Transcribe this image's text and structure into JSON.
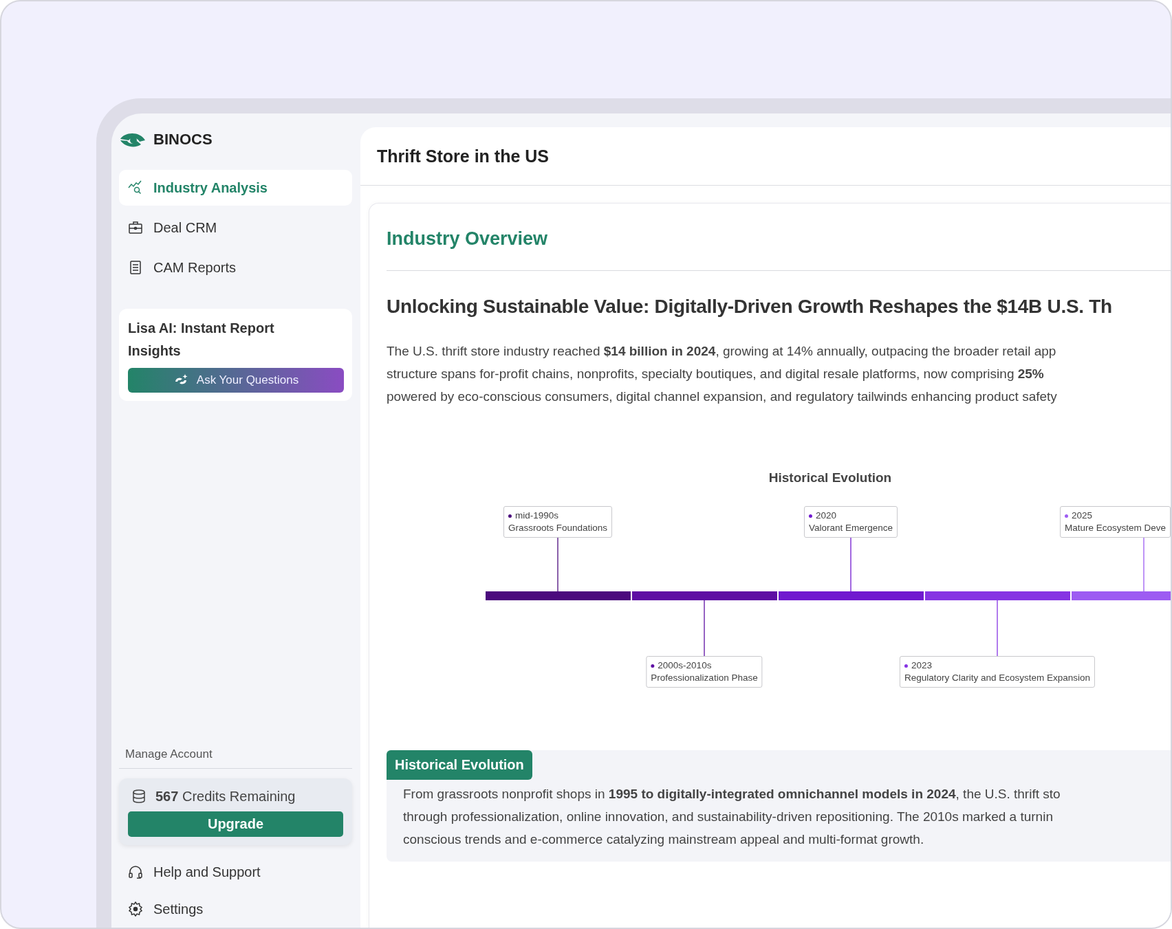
{
  "brand": {
    "name": "BINOCS"
  },
  "nav": [
    {
      "label": "Industry Analysis",
      "selected": true
    },
    {
      "label": "Deal CRM",
      "selected": false
    },
    {
      "label": "CAM Reports",
      "selected": false
    }
  ],
  "assistant": {
    "title": "Lisa AI: Instant Report Insights",
    "button": "Ask Your Questions"
  },
  "account": {
    "heading": "Manage Account",
    "credits": "**567** Credits Remaining",
    "upgrade": "Upgrade"
  },
  "footer_nav": [
    {
      "label": "Help and Support"
    },
    {
      "label": "Settings"
    }
  ],
  "page": {
    "title": "Thrift Store in the US"
  },
  "overview": {
    "heading": "Industry Overview",
    "headline": "Unlocking Sustainable Value: Digitally-Driven Growth Reshapes the $14B U.S. Th",
    "summary_lines": [
      "The U.S. thrift store industry reached **$14 billion in 2024**, growing at 14% annually, outpacing the broader retail app",
      "structure spans for-profit chains, nonprofits, specialty boutiques, and digital resale platforms, now comprising **25%**",
      "powered by eco-conscious consumers, digital channel expansion, and regulatory tailwinds enhancing product safety"
    ]
  },
  "timeline": {
    "title": "Historical Evolution",
    "events": [
      {
        "year": "mid-1990s",
        "label": "Grassroots Foundations",
        "above": true,
        "color": "#4b0a7d"
      },
      {
        "year": "2000s-2010s",
        "label": "Professionalization Phase",
        "above": false,
        "color": "#5e0fa3"
      },
      {
        "year": "2020",
        "label": "Valorant Emergence",
        "above": true,
        "color": "#7019cf"
      },
      {
        "year": "2023",
        "label": "Regulatory Clarity and Ecosystem Expansion",
        "above": false,
        "color": "#8634e3"
      },
      {
        "year": "2025",
        "label": "Mature Ecosystem Deve",
        "above": true,
        "color": "#9d5cf2"
      }
    ]
  },
  "history": {
    "badge": "Historical Evolution",
    "lines": [
      "From grassroots nonprofit shops in **1995 to digitally-integrated omnichannel models in 2024**, the U.S. thrift sto",
      "through professionalization, online innovation, and sustainability-driven repositioning. The 2010s marked a turnin",
      "conscious trends and e-commerce catalyzing mainstream appeal and multi-format growth."
    ]
  }
}
